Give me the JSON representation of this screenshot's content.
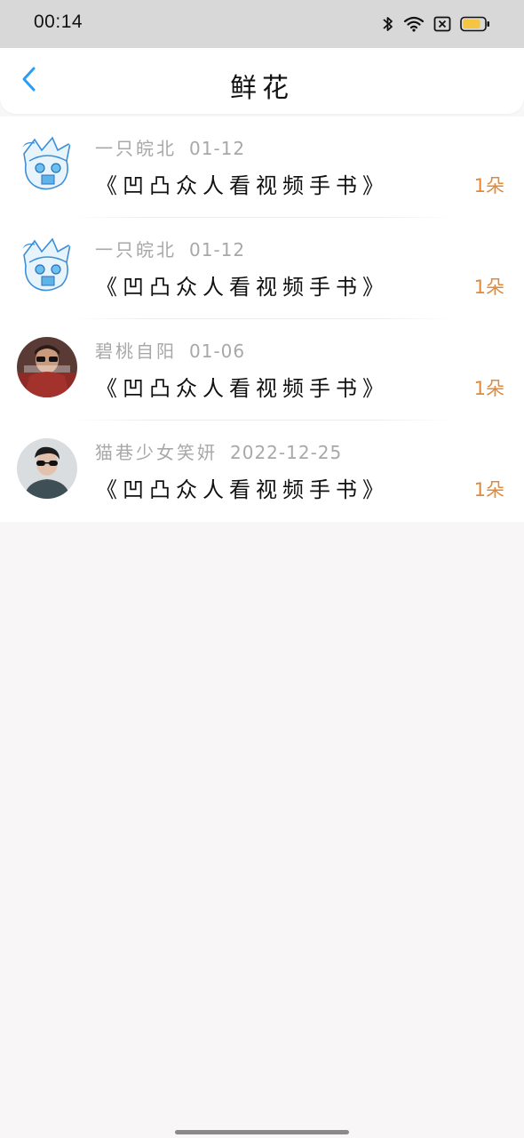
{
  "status_bar": {
    "time": "00:14",
    "icons": [
      "bluetooth-icon",
      "wifi-icon",
      "sim-error-icon",
      "battery-icon"
    ],
    "battery_color": "#f5c542"
  },
  "header": {
    "title": "鲜花",
    "back_icon": "chevron-left-icon",
    "accent_color": "#2a9df4"
  },
  "items": [
    {
      "user": "一只皖北",
      "date": "01-12",
      "title": "《凹凸众人看视频手书》",
      "count": "1朵",
      "avatar": "anime-avatar"
    },
    {
      "user": "一只皖北",
      "date": "01-12",
      "title": "《凹凸众人看视频手书》",
      "count": "1朵",
      "avatar": "anime-avatar"
    },
    {
      "user": "碧桃自阳",
      "date": "01-06",
      "title": "《凹凸众人看视频手书》",
      "count": "1朵",
      "avatar": "photo-avatar-red"
    },
    {
      "user": "猫巷少女笑妍",
      "date": "2022-12-25",
      "title": "《凹凸众人看视频手书》",
      "count": "1朵",
      "avatar": "photo-avatar-sunglasses"
    }
  ],
  "colors": {
    "count_color": "#e0893a",
    "meta_color": "#a8a8a8",
    "background": "#f8f6f7"
  }
}
